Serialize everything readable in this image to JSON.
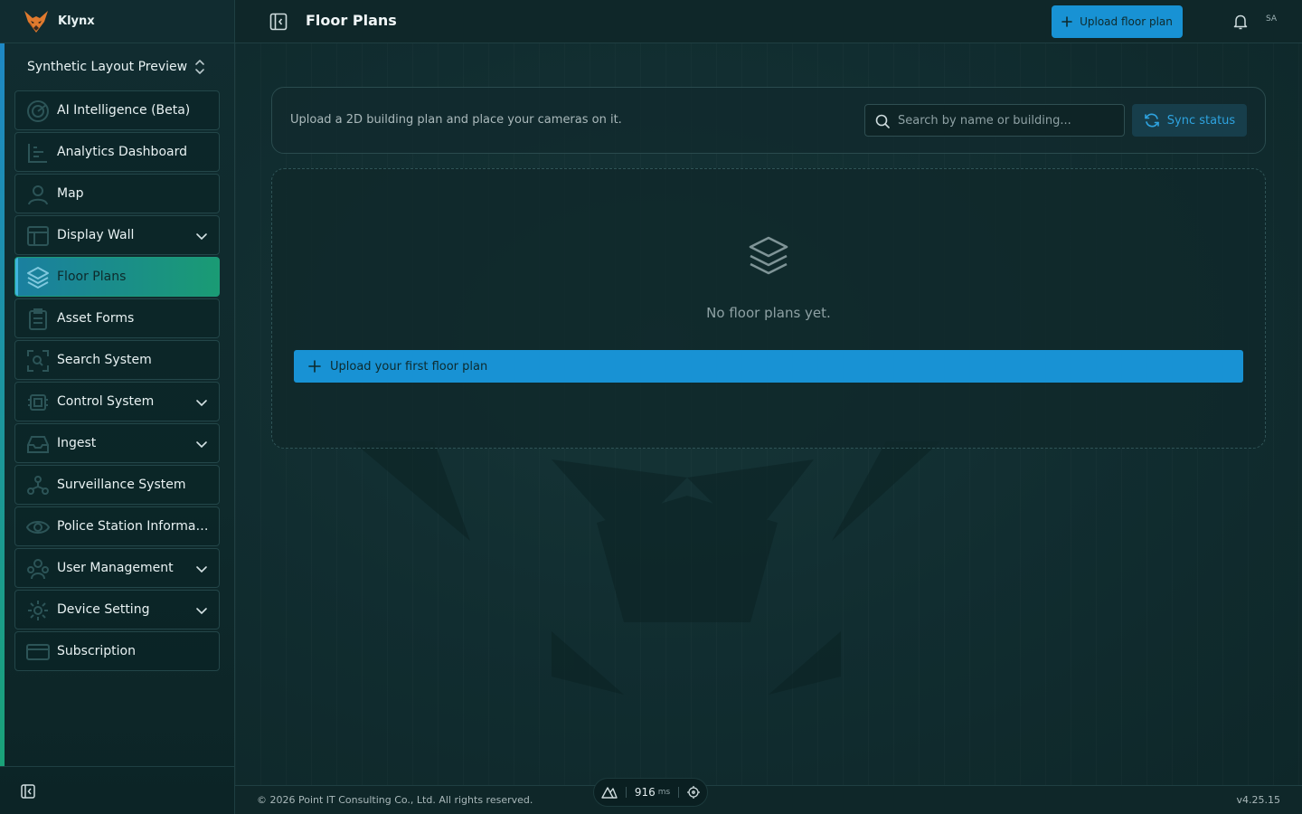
{
  "app": {
    "brand_name": "Klynx",
    "accent_color": "#1892d4",
    "active_gradient": [
      "#1a7fa0",
      "#1a9b74"
    ]
  },
  "sidebar": {
    "workspace_name": "Synthetic Layout Preview",
    "items": [
      {
        "label": "AI Intelligence (Beta)",
        "icon": "radar-icon",
        "has_submenu": false
      },
      {
        "label": "Analytics Dashboard",
        "icon": "chart-icon",
        "has_submenu": false
      },
      {
        "label": "Map",
        "icon": "map-pin-icon",
        "has_submenu": false
      },
      {
        "label": "Display Wall",
        "icon": "layout-icon",
        "has_submenu": true
      },
      {
        "label": "Floor Plans",
        "icon": "layers-icon",
        "has_submenu": false,
        "active": true
      },
      {
        "label": "Asset Forms",
        "icon": "clipboard-icon",
        "has_submenu": false
      },
      {
        "label": "Search System",
        "icon": "scan-search-icon",
        "has_submenu": false
      },
      {
        "label": "Control System",
        "icon": "cpu-icon",
        "has_submenu": true
      },
      {
        "label": "Ingest",
        "icon": "inbox-icon",
        "has_submenu": true
      },
      {
        "label": "Surveillance System",
        "icon": "network-icon",
        "has_submenu": false
      },
      {
        "label": "Police Station Informati...",
        "icon": "eye-icon",
        "has_submenu": false
      },
      {
        "label": "User Management",
        "icon": "users-icon",
        "has_submenu": true
      },
      {
        "label": "Device Setting",
        "icon": "gear-icon",
        "has_submenu": true
      },
      {
        "label": "Subscription",
        "icon": "credit-card-icon",
        "has_submenu": false
      }
    ]
  },
  "header": {
    "title": "Floor Plans",
    "upload_label": "Upload floor plan",
    "avatar_initials": "SA"
  },
  "toolbar": {
    "hint": "Upload a 2D building plan and place your cameras on it.",
    "search_placeholder": "Search by name or building...",
    "search_value": "",
    "sync_label": "Sync status"
  },
  "empty_state": {
    "message": "No floor plans yet.",
    "cta_label": "Upload your first floor plan"
  },
  "footer": {
    "copyright": "© 2026 Point IT Consulting Co., Ltd. All rights reserved.",
    "version": "v4.25.15"
  },
  "latency": {
    "value": "916",
    "unit": "ms"
  }
}
